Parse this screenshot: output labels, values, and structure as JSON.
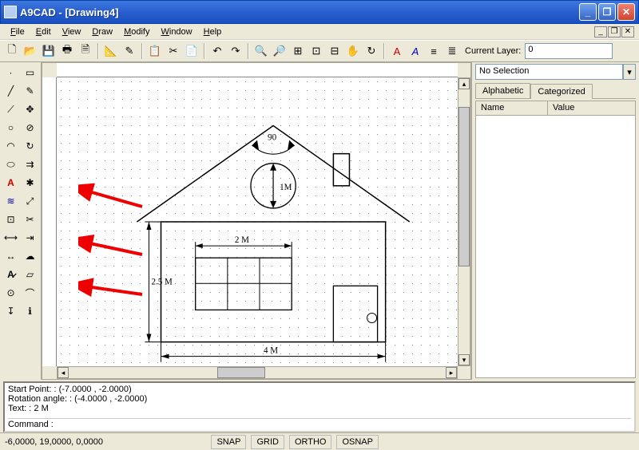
{
  "window": {
    "title": "A9CAD - [Drawing4]"
  },
  "menu": {
    "file": "File",
    "edit": "Edit",
    "view": "View",
    "draw": "Draw",
    "modify": "Modify",
    "window": "Window",
    "help": "Help"
  },
  "toolbar": {
    "layer_label": "Current Layer:",
    "layer_value": "0"
  },
  "properties": {
    "selection": "No Selection",
    "tab_alpha": "Alphabetic",
    "tab_cat": "Categorized",
    "col_name": "Name",
    "col_value": "Value"
  },
  "drawing": {
    "roof_angle": "90",
    "circle_diam": "1M",
    "window_width": "2 M",
    "wall_height": "2.5 M",
    "base_width": "4 M"
  },
  "console": {
    "line1": "Start Point: : (-7.0000 , -2.0000)",
    "line2": "Rotation angle: : (-4.0000 , -2.0000)",
    "line3": "Text: : 2 M",
    "prompt": "Command : "
  },
  "status": {
    "coords": "-6,0000, 19,0000, 0,0000",
    "snap": "SNAP",
    "grid": "GRID",
    "ortho": "ORTHO",
    "osnap": "OSNAP"
  }
}
